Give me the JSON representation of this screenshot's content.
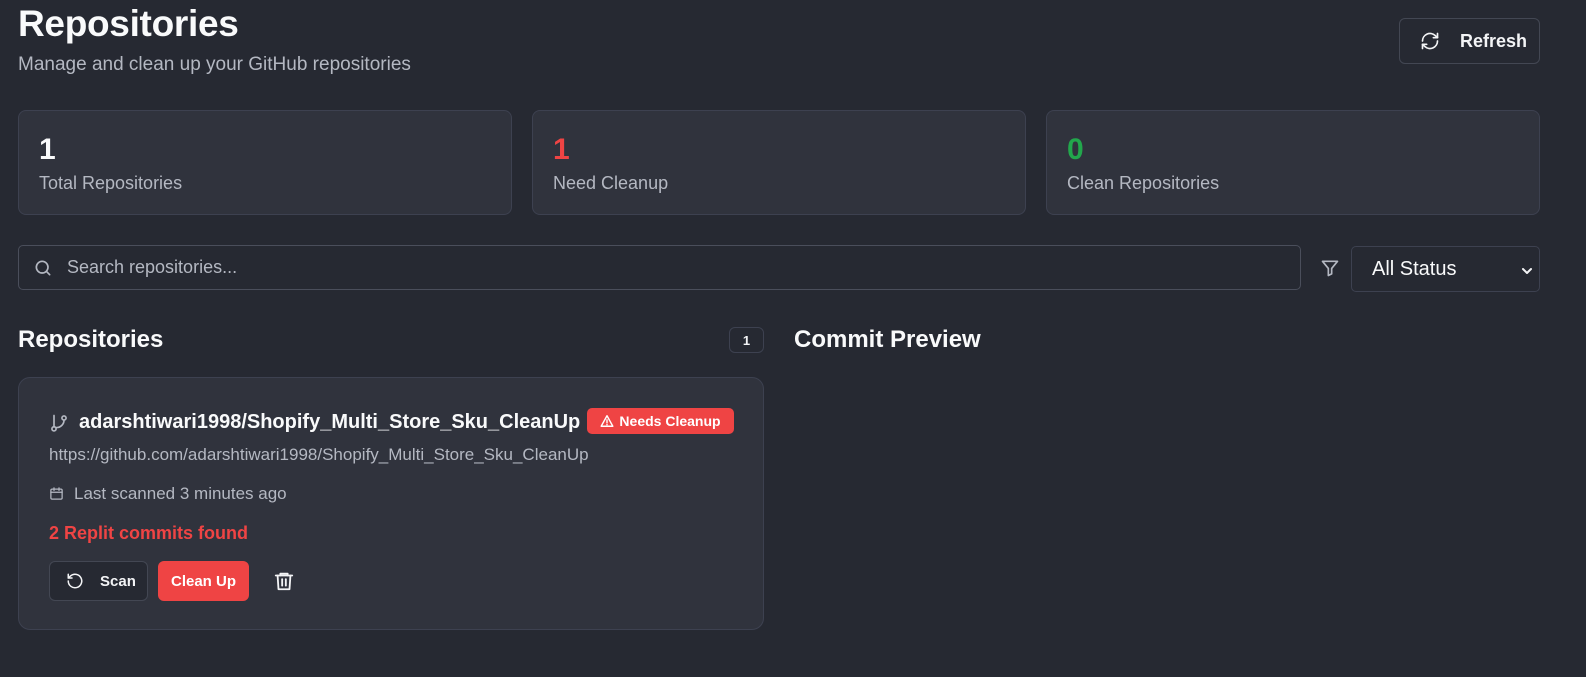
{
  "header": {
    "title": "Repositories",
    "subtitle": "Manage and clean up your GitHub repositories",
    "refresh_label": "Refresh",
    "refresh_icon": "refresh-icon"
  },
  "stats": [
    {
      "value": "1",
      "label": "Total Repositories",
      "color": "#f9fafb"
    },
    {
      "value": "1",
      "label": "Need Cleanup",
      "color": "#ef4444"
    },
    {
      "value": "0",
      "label": "Clean Repositories",
      "color": "#22a74c"
    }
  ],
  "search": {
    "placeholder": "Search repositories...",
    "value": "",
    "icon": "search-icon"
  },
  "filter": {
    "icon": "filter-icon",
    "selected": "All Status"
  },
  "repositories_section": {
    "title": "Repositories",
    "count": "1"
  },
  "commit_preview": {
    "title": "Commit Preview"
  },
  "repo_card": {
    "name": "adarshtiwari1998/Shopify_Multi_Store_Sku_CleanUp",
    "url": "https://github.com/adarshtiwari1998/Shopify_Multi_Store_Sku_CleanUp",
    "status": "Needs Cleanup",
    "last_scanned": "Last scanned 3 minutes ago",
    "commits_found": "2 Replit commits found",
    "scan_label": "Scan",
    "cleanup_label": "Clean Up"
  },
  "colors": {
    "background": "#262932",
    "card": "#30333d",
    "danger": "#ef4444",
    "success": "#22a74c",
    "muted_text": "#b4b8c2"
  }
}
